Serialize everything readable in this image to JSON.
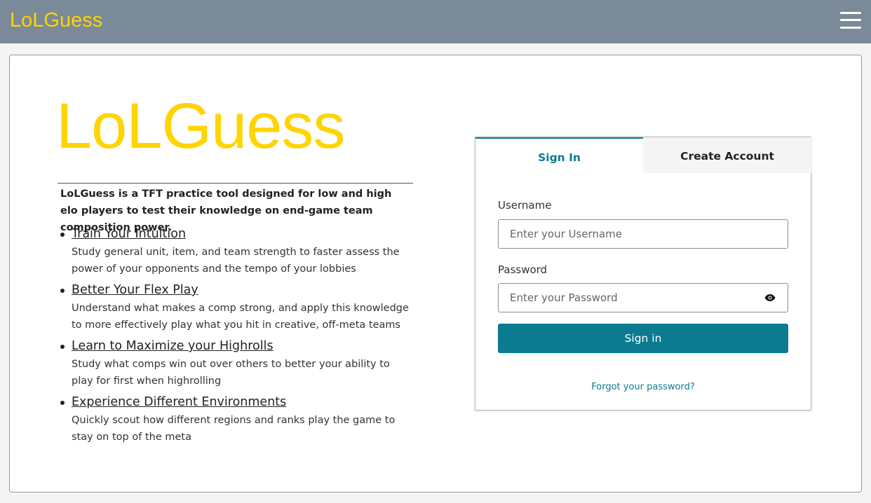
{
  "navbar": {
    "brand": "LoLGuess"
  },
  "hero": {
    "title": "LoLGuess",
    "intro": "LoLGuess is a TFT practice tool designed for low and high elo players to test their knowledge on end-game team composition power."
  },
  "features": [
    {
      "title": "Train Your Intuition",
      "description": "Study general unit, item, and team strength to faster assess the power of your opponents and the tempo of your lobbies"
    },
    {
      "title": "Better Your Flex Play",
      "description": "Understand what makes a comp strong, and apply this knowledge to more effectively play what you hit in creative, off-meta teams"
    },
    {
      "title": "Learn to Maximize your Highrolls",
      "description": "Study what comps win out over others to better your ability to play for first when highrolling"
    },
    {
      "title": "Experience Different Environments",
      "description": "Quickly scout how different regions and ranks play the game to stay on top of the meta"
    }
  ],
  "auth": {
    "tabs": {
      "signin": "Sign In",
      "create": "Create Account"
    },
    "username_label": "Username",
    "username_placeholder": "Enter your Username",
    "password_label": "Password",
    "password_placeholder": "Enter your Password",
    "signin_button": "Sign in",
    "forgot_link": "Forgot your password?"
  },
  "icons": {
    "menu": "hamburger-menu-icon",
    "show_password": "eye-icon"
  },
  "colors": {
    "brand_yellow": "#ffd400",
    "navbar_bg": "#7a8a99",
    "accent_teal": "#0c7a8f"
  }
}
